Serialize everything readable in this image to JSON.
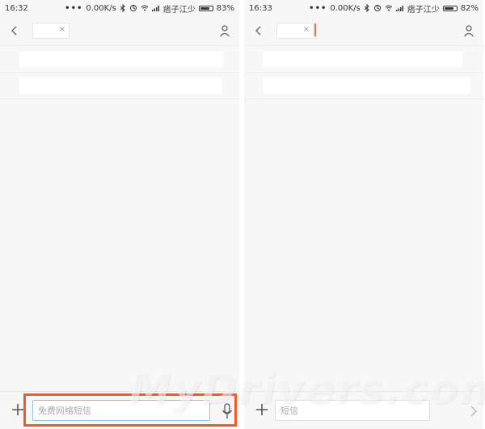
{
  "left": {
    "status": {
      "time": "16:32",
      "speed": "0.00K/s",
      "carrier": "痞子江少",
      "battery": "83%",
      "battery_level": 0.83
    },
    "input": {
      "placeholder": "免费网络短信"
    },
    "chip": {
      "close": "×"
    }
  },
  "right": {
    "status": {
      "time": "16:33",
      "speed": "0.00K/s",
      "carrier": "痞子江少",
      "battery": "82%",
      "battery_level": 0.82
    },
    "input": {
      "placeholder": "短信"
    },
    "chip": {
      "close": "×"
    }
  },
  "watermark": "MyDrivers.com",
  "icons": {
    "back": "chevron-left-icon",
    "contact": "person-icon",
    "add": "plus-icon",
    "mic": "microphone-icon",
    "send": "send-arrow-icon",
    "bluetooth": "bluetooth-icon",
    "sync": "sync-icon",
    "wifi": "wifi-icon",
    "signal": "signal-icon",
    "battery": "battery-icon"
  },
  "colors": {
    "highlight": "#f05a28",
    "cursor": "#ff6a3d",
    "input_focus": "#8ec3e6",
    "background": "#f7f7f7"
  }
}
